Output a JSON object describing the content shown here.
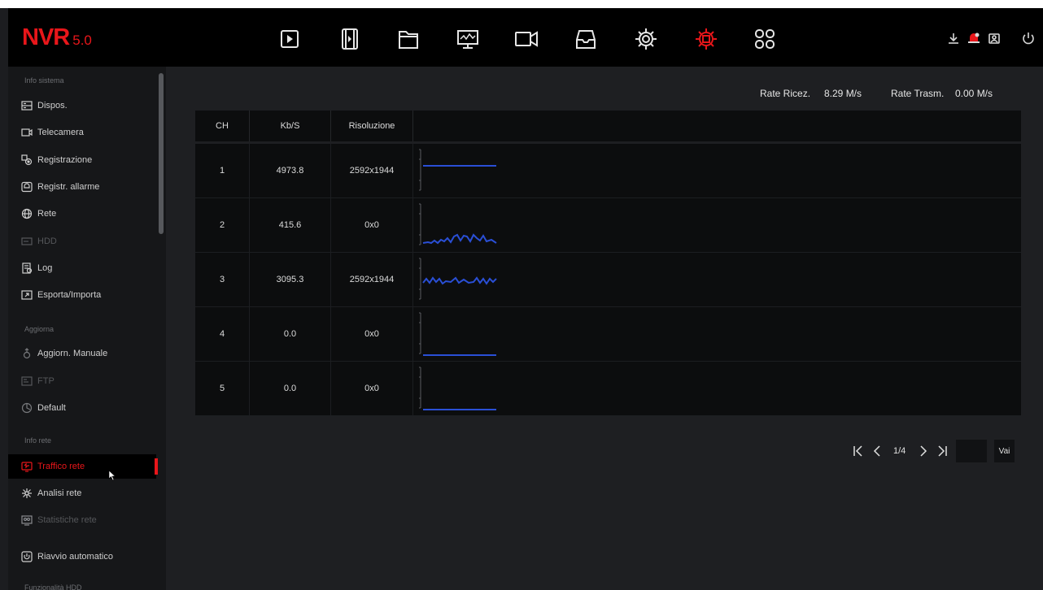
{
  "app": {
    "logo_main": "NVR",
    "logo_version": "5.0"
  },
  "topbar": {
    "nav_icons": [
      "playback-icon",
      "video-clip-icon",
      "file-icon",
      "monitor-icon",
      "camera-icon",
      "storage-icon",
      "settings-icon",
      "system-settings-icon",
      "apps-icon"
    ],
    "active_icon": "system-settings-icon",
    "right_icons": [
      "download-icon",
      "alarm-icon",
      "account-icon",
      "power-icon"
    ]
  },
  "sidebar": {
    "sections": [
      {
        "title": "Info sistema",
        "items": [
          {
            "label": "Dispos.",
            "icon": "device-icon",
            "state": "normal"
          },
          {
            "label": "Telecamera",
            "icon": "camera-icon",
            "state": "normal"
          },
          {
            "label": "Registrazione",
            "icon": "record-icon",
            "state": "normal"
          },
          {
            "label": "Registr. allarme",
            "icon": "alarm-record-icon",
            "state": "normal"
          },
          {
            "label": "Rete",
            "icon": "network-icon",
            "state": "normal"
          },
          {
            "label": "HDD",
            "icon": "hdd-icon",
            "state": "dim"
          },
          {
            "label": "Log",
            "icon": "log-icon",
            "state": "normal"
          },
          {
            "label": "Esporta/Importa",
            "icon": "export-icon",
            "state": "normal"
          }
        ]
      },
      {
        "title": "Aggiorna",
        "items": [
          {
            "label": "Aggiorn. Manuale",
            "icon": "upgrade-icon",
            "state": "normal"
          },
          {
            "label": "FTP",
            "icon": "ftp-icon",
            "state": "dim"
          },
          {
            "label": "Default",
            "icon": "default-icon",
            "state": "normal"
          }
        ]
      },
      {
        "title": "Info rete",
        "items": [
          {
            "label": "Traffico rete",
            "icon": "traffic-icon",
            "state": "active"
          },
          {
            "label": "Analisi rete",
            "icon": "analysis-icon",
            "state": "normal"
          },
          {
            "label": "Statistiche rete",
            "icon": "stats-icon",
            "state": "dim"
          },
          {
            "label": "Riavvio automatico",
            "icon": "reboot-icon",
            "state": "normal"
          }
        ]
      },
      {
        "title": "Funzionalità HDD",
        "items": []
      }
    ]
  },
  "main": {
    "rate_rx_label": "Rate Ricez.",
    "rate_rx_value": "8.29 M/s",
    "rate_tx_label": "Rate Trasm.",
    "rate_tx_value": "0.00 M/s",
    "table": {
      "headers": [
        "CH",
        "Kb/S",
        "Risoluzione",
        ""
      ],
      "rows": [
        {
          "ch": "1",
          "kbs": "4973.8",
          "res": "2592x1944",
          "trend": "flat-high"
        },
        {
          "ch": "2",
          "kbs": "415.6",
          "res": "0x0",
          "trend": "wave-low"
        },
        {
          "ch": "3",
          "kbs": "3095.3",
          "res": "2592x1944",
          "trend": "wave-mid"
        },
        {
          "ch": "4",
          "kbs": "0.0",
          "res": "0x0",
          "trend": "flat-zero"
        },
        {
          "ch": "5",
          "kbs": "0.0",
          "res": "0x0",
          "trend": "flat-zero"
        }
      ]
    },
    "pagination": {
      "page": "1/4",
      "go_label": "Vai",
      "page_input": ""
    }
  },
  "colors": {
    "accent": "#e8161a",
    "graph_line": "#2a4fd6"
  }
}
